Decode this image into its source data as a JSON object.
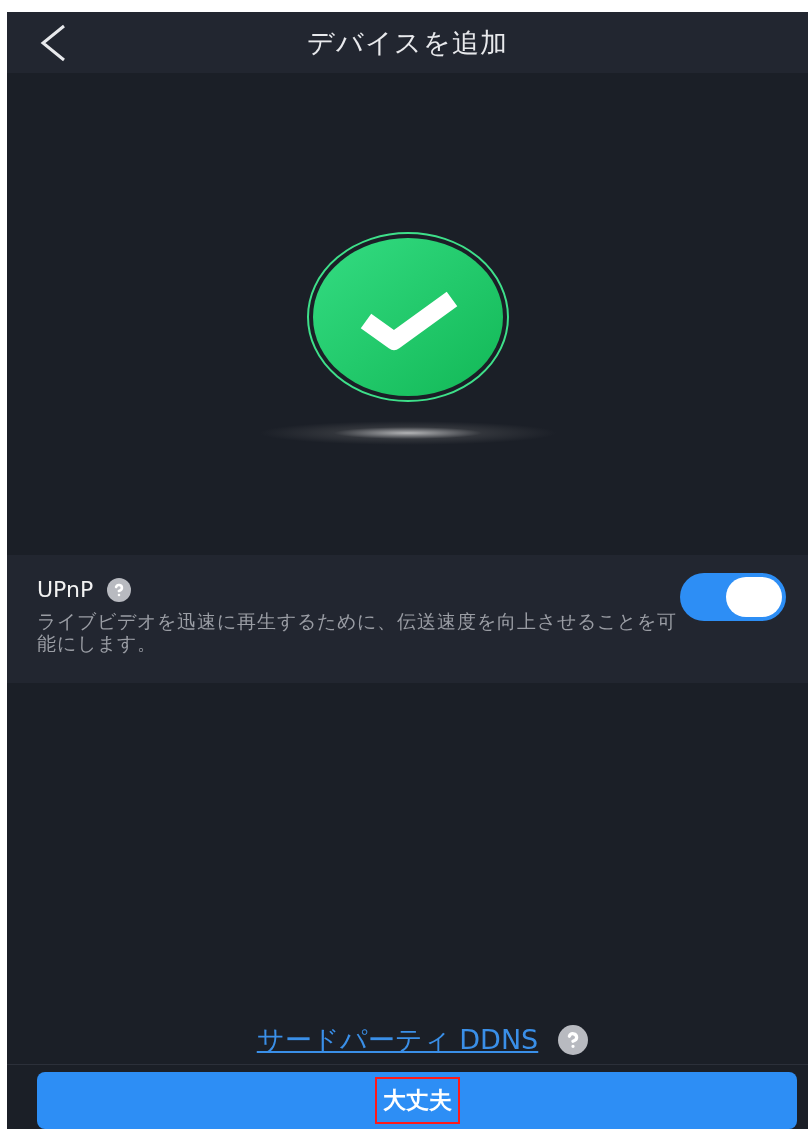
{
  "header": {
    "title": "デバイスを追加"
  },
  "status": {
    "kind": "success"
  },
  "upnp": {
    "label": "UPnP",
    "description": "ライブビデオを迅速に再生するために、伝送速度を向上させることを可能にします。",
    "on": true
  },
  "ddns_link": {
    "label": "サードパーティ DDNS"
  },
  "confirm_button": {
    "label": "大丈夫",
    "highlighted": true
  }
}
